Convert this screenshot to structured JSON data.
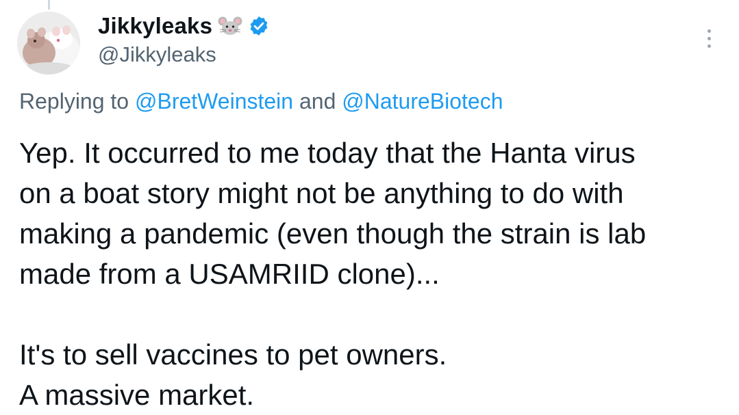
{
  "tweet": {
    "author": {
      "display_name": "Jikkyleaks",
      "name_emoji": "🐭",
      "handle": "@Jikkyleaks",
      "verified": true,
      "avatar_icon": "rats-photo-avatar"
    },
    "replying": {
      "prefix": "Replying to",
      "mention_1": "@BretWeinstein",
      "conjunction": "and",
      "mention_2": "@NatureBiotech"
    },
    "body_lines": [
      "Yep. It occurred to me today that the Hanta virus",
      "on a boat story might not be anything to do with",
      "making a pandemic (even though the strain is lab",
      "made from a USAMRIID clone)...",
      "",
      "It's to sell vaccines to pet owners.",
      "A massive market."
    ],
    "more_menu_icon": "more-vertical-icon"
  },
  "colors": {
    "text_primary": "#0f1419",
    "text_secondary": "#536471",
    "link": "#1d9bf0",
    "verified": "#1d9bf0"
  }
}
